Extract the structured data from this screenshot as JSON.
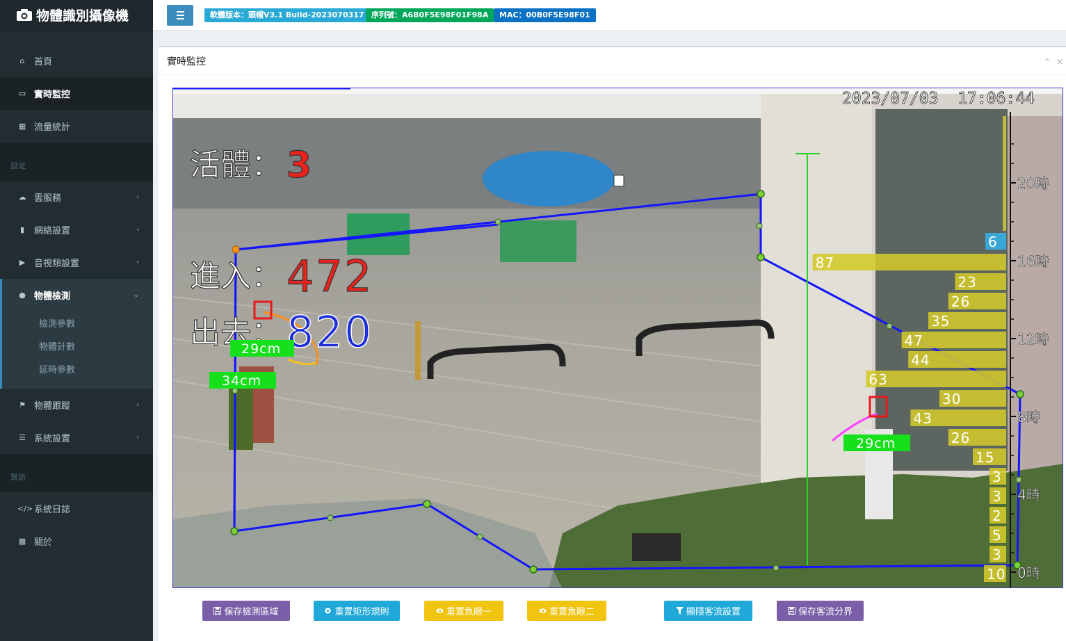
{
  "app": {
    "title": "物體識別攝像機"
  },
  "topbar": {
    "badges": [
      {
        "text": "軟體版本：頭帽V3.1 Build-2023070317",
        "color": "#29a9d6"
      },
      {
        "text": "序列號：A6B0F5E98F01F98A",
        "color": "#00a65a"
      },
      {
        "text": "MAC：00B0F5E98F01",
        "color": "#0b71c4"
      }
    ]
  },
  "sidebar": {
    "items": [
      {
        "label": "首頁",
        "icon": "home-icon"
      },
      {
        "label": "實時監控",
        "icon": "monitor-icon"
      },
      {
        "label": "流量統計",
        "icon": "calendar-icon"
      }
    ],
    "section_settings": "設定",
    "settings": [
      {
        "label": "雲服務",
        "icon": "cloud-icon"
      },
      {
        "label": "網絡設置",
        "icon": "signal-icon"
      },
      {
        "label": "音視頻設置",
        "icon": "video-icon"
      },
      {
        "label": "物體檢測",
        "icon": "apple-icon"
      }
    ],
    "sub_items": [
      "檢測參數",
      "物體計數",
      "延時參數"
    ],
    "settings2": [
      {
        "label": "物體跟蹤",
        "icon": "flag-icon"
      },
      {
        "label": "系統設置",
        "icon": "list-icon"
      }
    ],
    "section_help": "幫助",
    "help": [
      {
        "label": "系統日誌",
        "icon": "code-icon"
      },
      {
        "label": "關於",
        "icon": "qrcode-icon"
      }
    ]
  },
  "panel": {
    "title": "實時監控"
  },
  "video": {
    "timestamp": "2023/07/03  17:06:44",
    "alive_label": "活體：",
    "alive_value": "3",
    "enter_label": "進入：",
    "enter_value": "472",
    "exit_label": "出去：",
    "exit_value": "820",
    "tags": [
      "29cm",
      "34cm",
      "29cm"
    ],
    "hist_top": "6",
    "hist_values": [
      "87",
      "23",
      "26",
      "35",
      "47",
      "44",
      "63",
      "30",
      "43",
      "26",
      "15",
      "3",
      "3",
      "2",
      "5",
      "3",
      "10"
    ],
    "hours": [
      "20時",
      "16時",
      "12時",
      "8時",
      "4時",
      "0時"
    ]
  },
  "buttons": [
    {
      "label": "保存檢測區域",
      "icon": "save-icon",
      "color": "#7a5fa8"
    },
    {
      "label": "重置矩形規則",
      "icon": "gear-icon",
      "color": "#1fa8d8"
    },
    {
      "label": "重置魚眼一",
      "icon": "eye-icon",
      "color": "#f1c40f"
    },
    {
      "label": "重置魚眼二",
      "icon": "eye-icon",
      "color": "#f1c40f"
    },
    {
      "label": "顯隱客流設置",
      "icon": "filter-icon",
      "color": "#1fa8d8"
    },
    {
      "label": "保存客流分界",
      "icon": "save-icon",
      "color": "#7a5fa8"
    }
  ]
}
